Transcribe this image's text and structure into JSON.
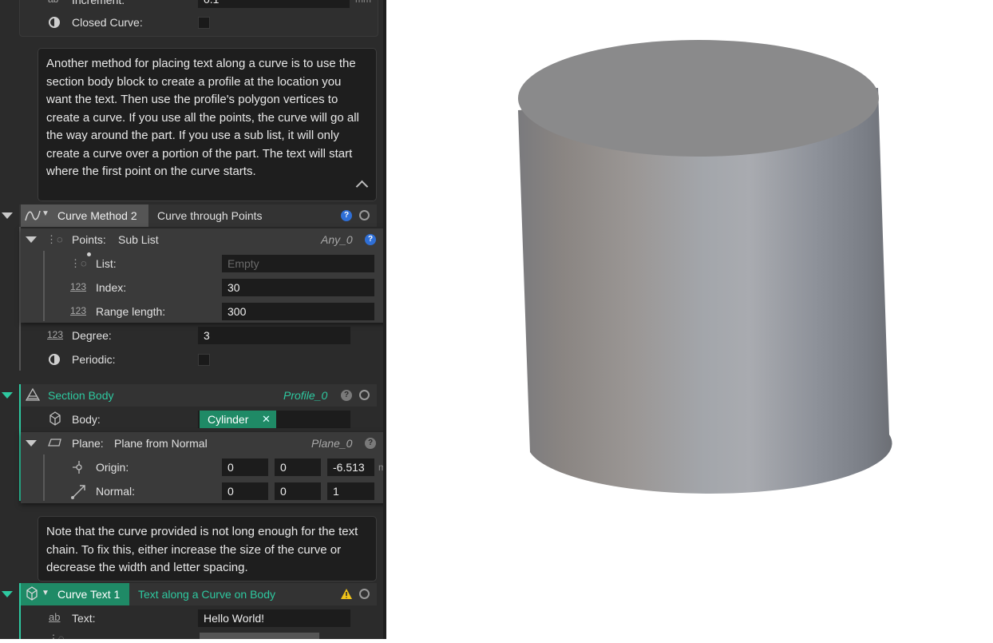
{
  "top": {
    "increment_label": "Increment:",
    "increment_value": "0.1",
    "increment_unit": "mm",
    "closed_curve_label": "Closed Curve:"
  },
  "note1": {
    "text": "Another method for placing text along a curve is to use the section body block to create a profile at the location you want the text. Then use the profile's polygon vertices to create a curve. If you use all the points, the curve will go all the way around the part. If you use a sub list, it will only create a curve over a portion of the part. The text will start where the first point on the curve starts."
  },
  "curve_method": {
    "name": "Curve Method 2",
    "type": "Curve through Points"
  },
  "points": {
    "label": "Points:",
    "type": "Sub List",
    "output": "Any_0",
    "list_label": "List:",
    "list_placeholder": "Empty",
    "index_label": "Index:",
    "index_value": "30",
    "range_label": "Range length:",
    "range_value": "300"
  },
  "degree": {
    "label": "Degree:",
    "value": "3"
  },
  "periodic": {
    "label": "Periodic:"
  },
  "section_body": {
    "name": "Section Body",
    "output": "Profile_0",
    "body_label": "Body:",
    "body_value": "Cylinder",
    "plane_label": "Plane:",
    "plane_type": "Plane from Normal",
    "plane_output": "Plane_0",
    "origin_label": "Origin:",
    "origin_x": "0",
    "origin_y": "0",
    "origin_z": "-6.513",
    "origin_unit": "mm",
    "normal_label": "Normal:",
    "normal_x": "0",
    "normal_y": "0",
    "normal_z": "1"
  },
  "note2": {
    "text": "Note that the curve provided is not long enough for the text chain. To fix this, either increase the size of the curve or decrease the width and letter spacing."
  },
  "curve_text": {
    "name": "Curve Text 1",
    "type": "Text along a Curve on Body",
    "text_label": "Text:",
    "text_value": "Hello World!"
  },
  "icons": {
    "help": "?",
    "remove": "✕",
    "collapse": "^"
  },
  "colors": {
    "accent_green": "#2ec9a0",
    "chip_green": "#1f8a66",
    "help_blue": "#2f6fd6",
    "warning": "#f0c419",
    "panel_bg": "#2b2b2b"
  }
}
